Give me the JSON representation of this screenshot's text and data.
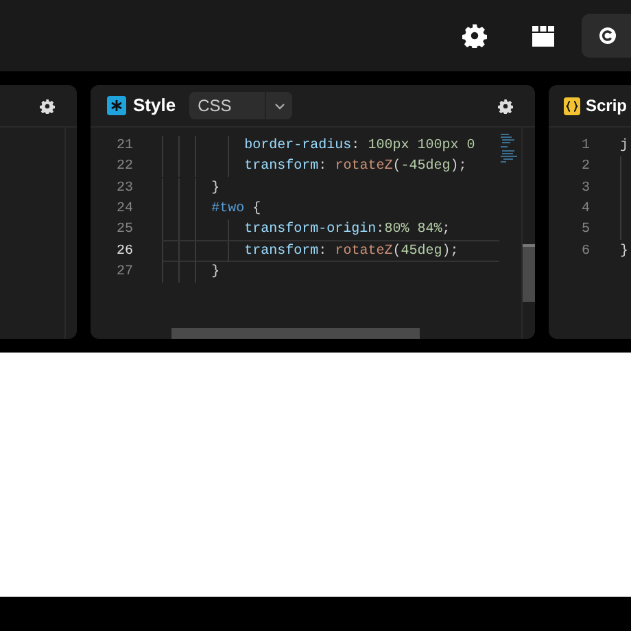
{
  "style_panel": {
    "title": "Style",
    "language": "CSS",
    "lines": [
      {
        "number": "21",
        "current": false,
        "kind": "declaration",
        "tokens": [
          {
            "kind": "property",
            "text": "border-radius"
          },
          {
            "kind": "punct",
            "text": ": "
          },
          {
            "kind": "number",
            "text": "100px 100px 0"
          }
        ]
      },
      {
        "number": "22",
        "current": false,
        "kind": "declaration",
        "tokens": [
          {
            "kind": "property",
            "text": "transform"
          },
          {
            "kind": "punct",
            "text": ": "
          },
          {
            "kind": "function",
            "text": "rotateZ"
          },
          {
            "kind": "punct",
            "text": "("
          },
          {
            "kind": "number",
            "text": "-45deg"
          },
          {
            "kind": "punct",
            "text": ");"
          }
        ]
      },
      {
        "number": "23",
        "current": false,
        "kind": "rule",
        "tokens": [
          {
            "kind": "punct",
            "text": "}"
          }
        ]
      },
      {
        "number": "24",
        "current": false,
        "kind": "rule",
        "tokens": [
          {
            "kind": "selector",
            "text": "#two"
          },
          {
            "kind": "punct",
            "text": " {"
          }
        ]
      },
      {
        "number": "25",
        "current": false,
        "kind": "declaration",
        "tokens": [
          {
            "kind": "property",
            "text": "transform-origin"
          },
          {
            "kind": "punct",
            "text": ":"
          },
          {
            "kind": "number",
            "text": "80% 84%"
          },
          {
            "kind": "punct",
            "text": ";"
          }
        ]
      },
      {
        "number": "26",
        "current": true,
        "kind": "declaration",
        "tokens": [
          {
            "kind": "property",
            "text": "transform"
          },
          {
            "kind": "punct",
            "text": ": "
          },
          {
            "kind": "function",
            "text": "rotateZ"
          },
          {
            "kind": "punct",
            "text": "("
          },
          {
            "kind": "number",
            "text": "45deg"
          },
          {
            "kind": "punct",
            "text": ");"
          }
        ]
      },
      {
        "number": "27",
        "current": false,
        "kind": "rule",
        "tokens": [
          {
            "kind": "punct",
            "text": "}"
          }
        ]
      }
    ]
  },
  "script_panel": {
    "title": "Scrip",
    "lines": [
      {
        "number": "1",
        "text": "j"
      },
      {
        "number": "2"
      },
      {
        "number": "3"
      },
      {
        "number": "4"
      },
      {
        "number": "5"
      },
      {
        "number": "6",
        "text": "}"
      }
    ]
  }
}
